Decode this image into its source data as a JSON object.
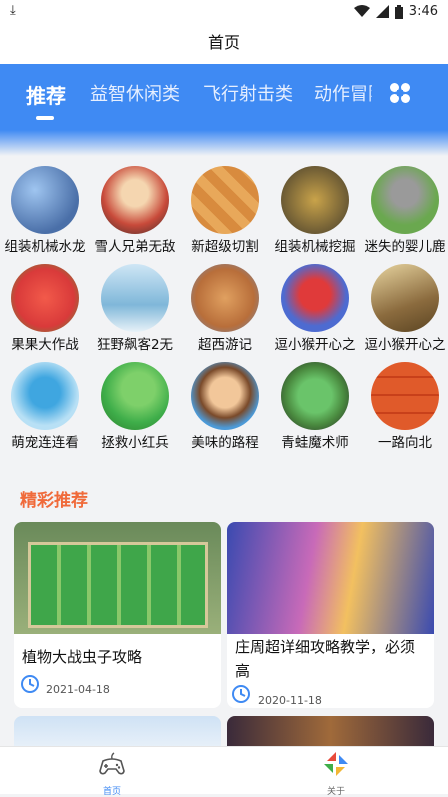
{
  "status": {
    "time": "3:46",
    "download_icon": "download-icon",
    "wifi_icon": "wifi-icon",
    "signal_icon": "signal-icon",
    "battery_icon": "battery-icon"
  },
  "header": {
    "title": "首页"
  },
  "tabs": [
    {
      "label": "推荐",
      "active": true
    },
    {
      "label": "益智休闲类",
      "active": false
    },
    {
      "label": "飞行射击类",
      "active": false
    },
    {
      "label": "动作冒险",
      "active": false
    }
  ],
  "games": [
    {
      "label": "组装机械水龙",
      "color": "#4a6fa8"
    },
    {
      "label": "雪人兄弟无敌",
      "color": "#c84a3a"
    },
    {
      "label": "新超级切割",
      "color": "#d88b3e"
    },
    {
      "label": "组装机械挖掘",
      "color": "#6b5a34"
    },
    {
      "label": "迷失的婴儿鹿",
      "color": "#6aa84f"
    },
    {
      "label": "果果大作战",
      "color": "#d93a3a"
    },
    {
      "label": "狂野飙客2无",
      "color": "#7fb7d9"
    },
    {
      "label": "超西游记",
      "color": "#b86e3a"
    },
    {
      "label": "逗小猴开心之",
      "color": "#4d6bd1"
    },
    {
      "label": "逗小猴开心之",
      "color": "#8b6b3e"
    },
    {
      "label": "萌宠连连看",
      "color": "#5aa6d6"
    },
    {
      "label": "拯救小红兵",
      "color": "#3fae4a"
    },
    {
      "label": "美味的路程",
      "color": "#4c9ad8"
    },
    {
      "label": "青蛙魔术师",
      "color": "#4a8a3f"
    },
    {
      "label": "一路向北",
      "color": "#e05a2a"
    }
  ],
  "section": {
    "title": "精彩推荐"
  },
  "articles": [
    {
      "title": "植物大战虫子攻略",
      "date": "2021-04-18"
    },
    {
      "title_line1": "庄周超详细攻略教学，必须",
      "title_line2": "高",
      "date": "2020-11-18"
    }
  ],
  "nav": [
    {
      "label": "首页",
      "icon": "gamepad-icon",
      "color": "#3f8af3"
    },
    {
      "label": "关于",
      "icon": "app-logo-icon",
      "color": "#666666"
    }
  ]
}
